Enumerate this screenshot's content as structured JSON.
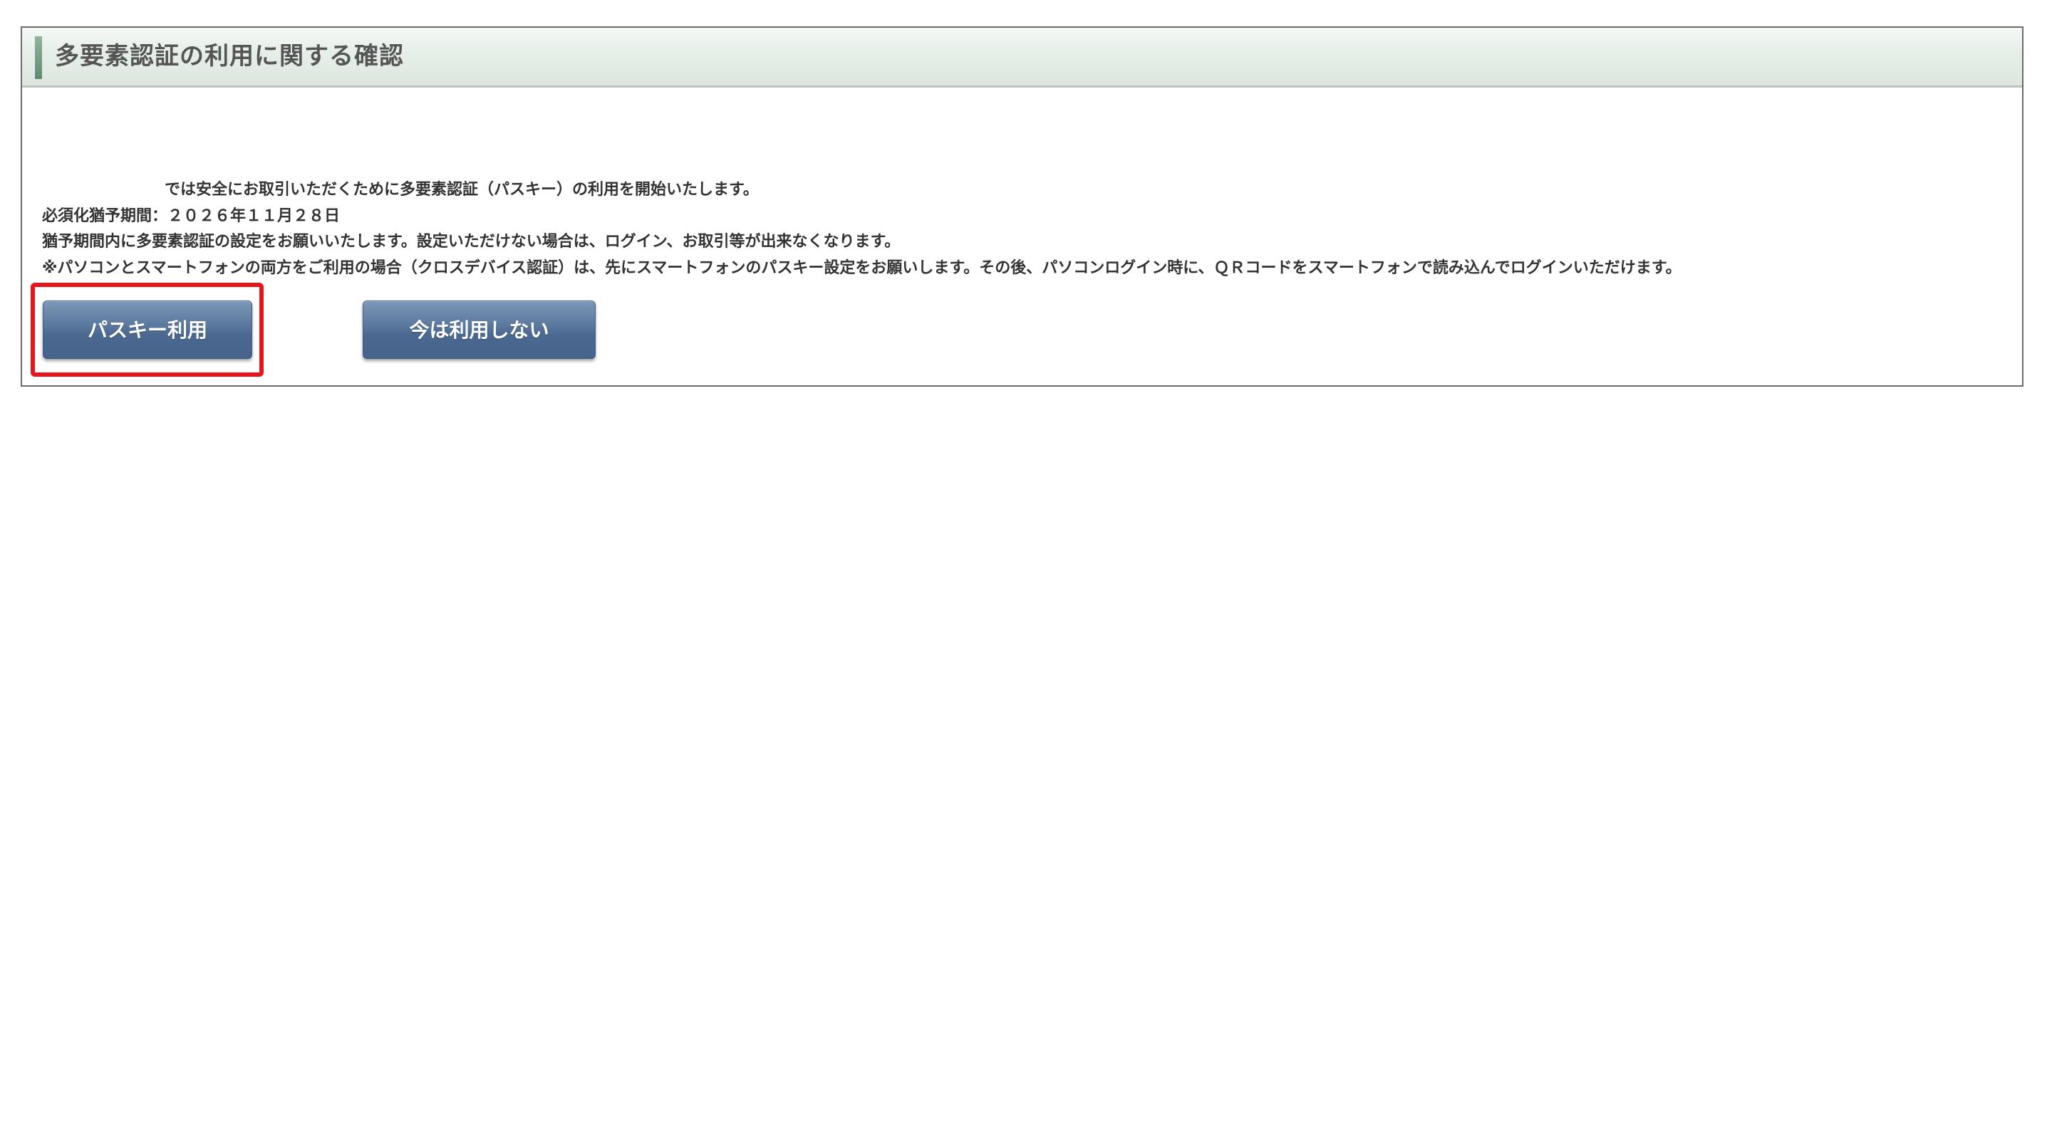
{
  "panel": {
    "title": "多要素認証の利用に関する確認"
  },
  "message": {
    "line1": "では安全にお取引いただくために多要素認証（パスキー）の利用を開始いたします。",
    "line2": "必須化猶予期間：２０２６年１１月２８日",
    "line3": "猶予期間内に多要素認証の設定をお願いいたします。設定いただけない場合は、ログイン、お取引等が出来なくなります。",
    "line4": "※パソコンとスマートフォンの両方をご利用の場合（クロスデバイス認証）は、先にスマートフォンのパスキー設定をお願いします。その後、パソコンログイン時に、ＱＲコードをスマートフォンで読み込んでログインいただけます。"
  },
  "buttons": {
    "passkey_label": "パスキー利用",
    "later_label": "今は利用しない"
  },
  "colors": {
    "highlight": "#e8141c",
    "button": "#5d7aa0",
    "header_accent": "#6f9a7f"
  }
}
